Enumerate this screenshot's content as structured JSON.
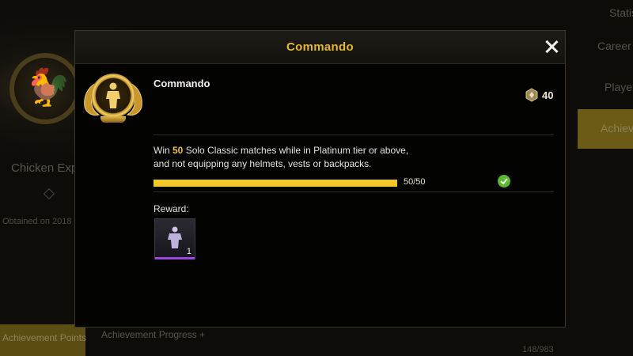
{
  "background": {
    "left_title": "Chicken Expe",
    "left_date": "Obtained on 2018",
    "right_tabs": [
      "Statis",
      "Career",
      "Player",
      "Achiev"
    ],
    "bottom_left_button": "Achievement Points",
    "bottom_progress": "Achievement Progress +",
    "bottom_count": "148/983"
  },
  "modal": {
    "title": "Commando",
    "achievement_name": "Commando",
    "points": "40",
    "description_prefix": "Win ",
    "description_highlight": "50",
    "description_line1_rest": " Solo Classic matches while in Platinum tier or above,",
    "description_line2": "and not equipping any helmets, vests or backpacks.",
    "progress": {
      "current": 50,
      "total": 50,
      "label": "50/50",
      "complete": true
    },
    "reward_label": "Reward:",
    "reward": {
      "count": "1",
      "icon": "outfit-figure-icon",
      "rarity_color": "#9a48e0"
    }
  },
  "colors": {
    "accent_gold": "#e3b833",
    "progress_fill": "#f2c828",
    "complete_green": "#5ab82c"
  }
}
